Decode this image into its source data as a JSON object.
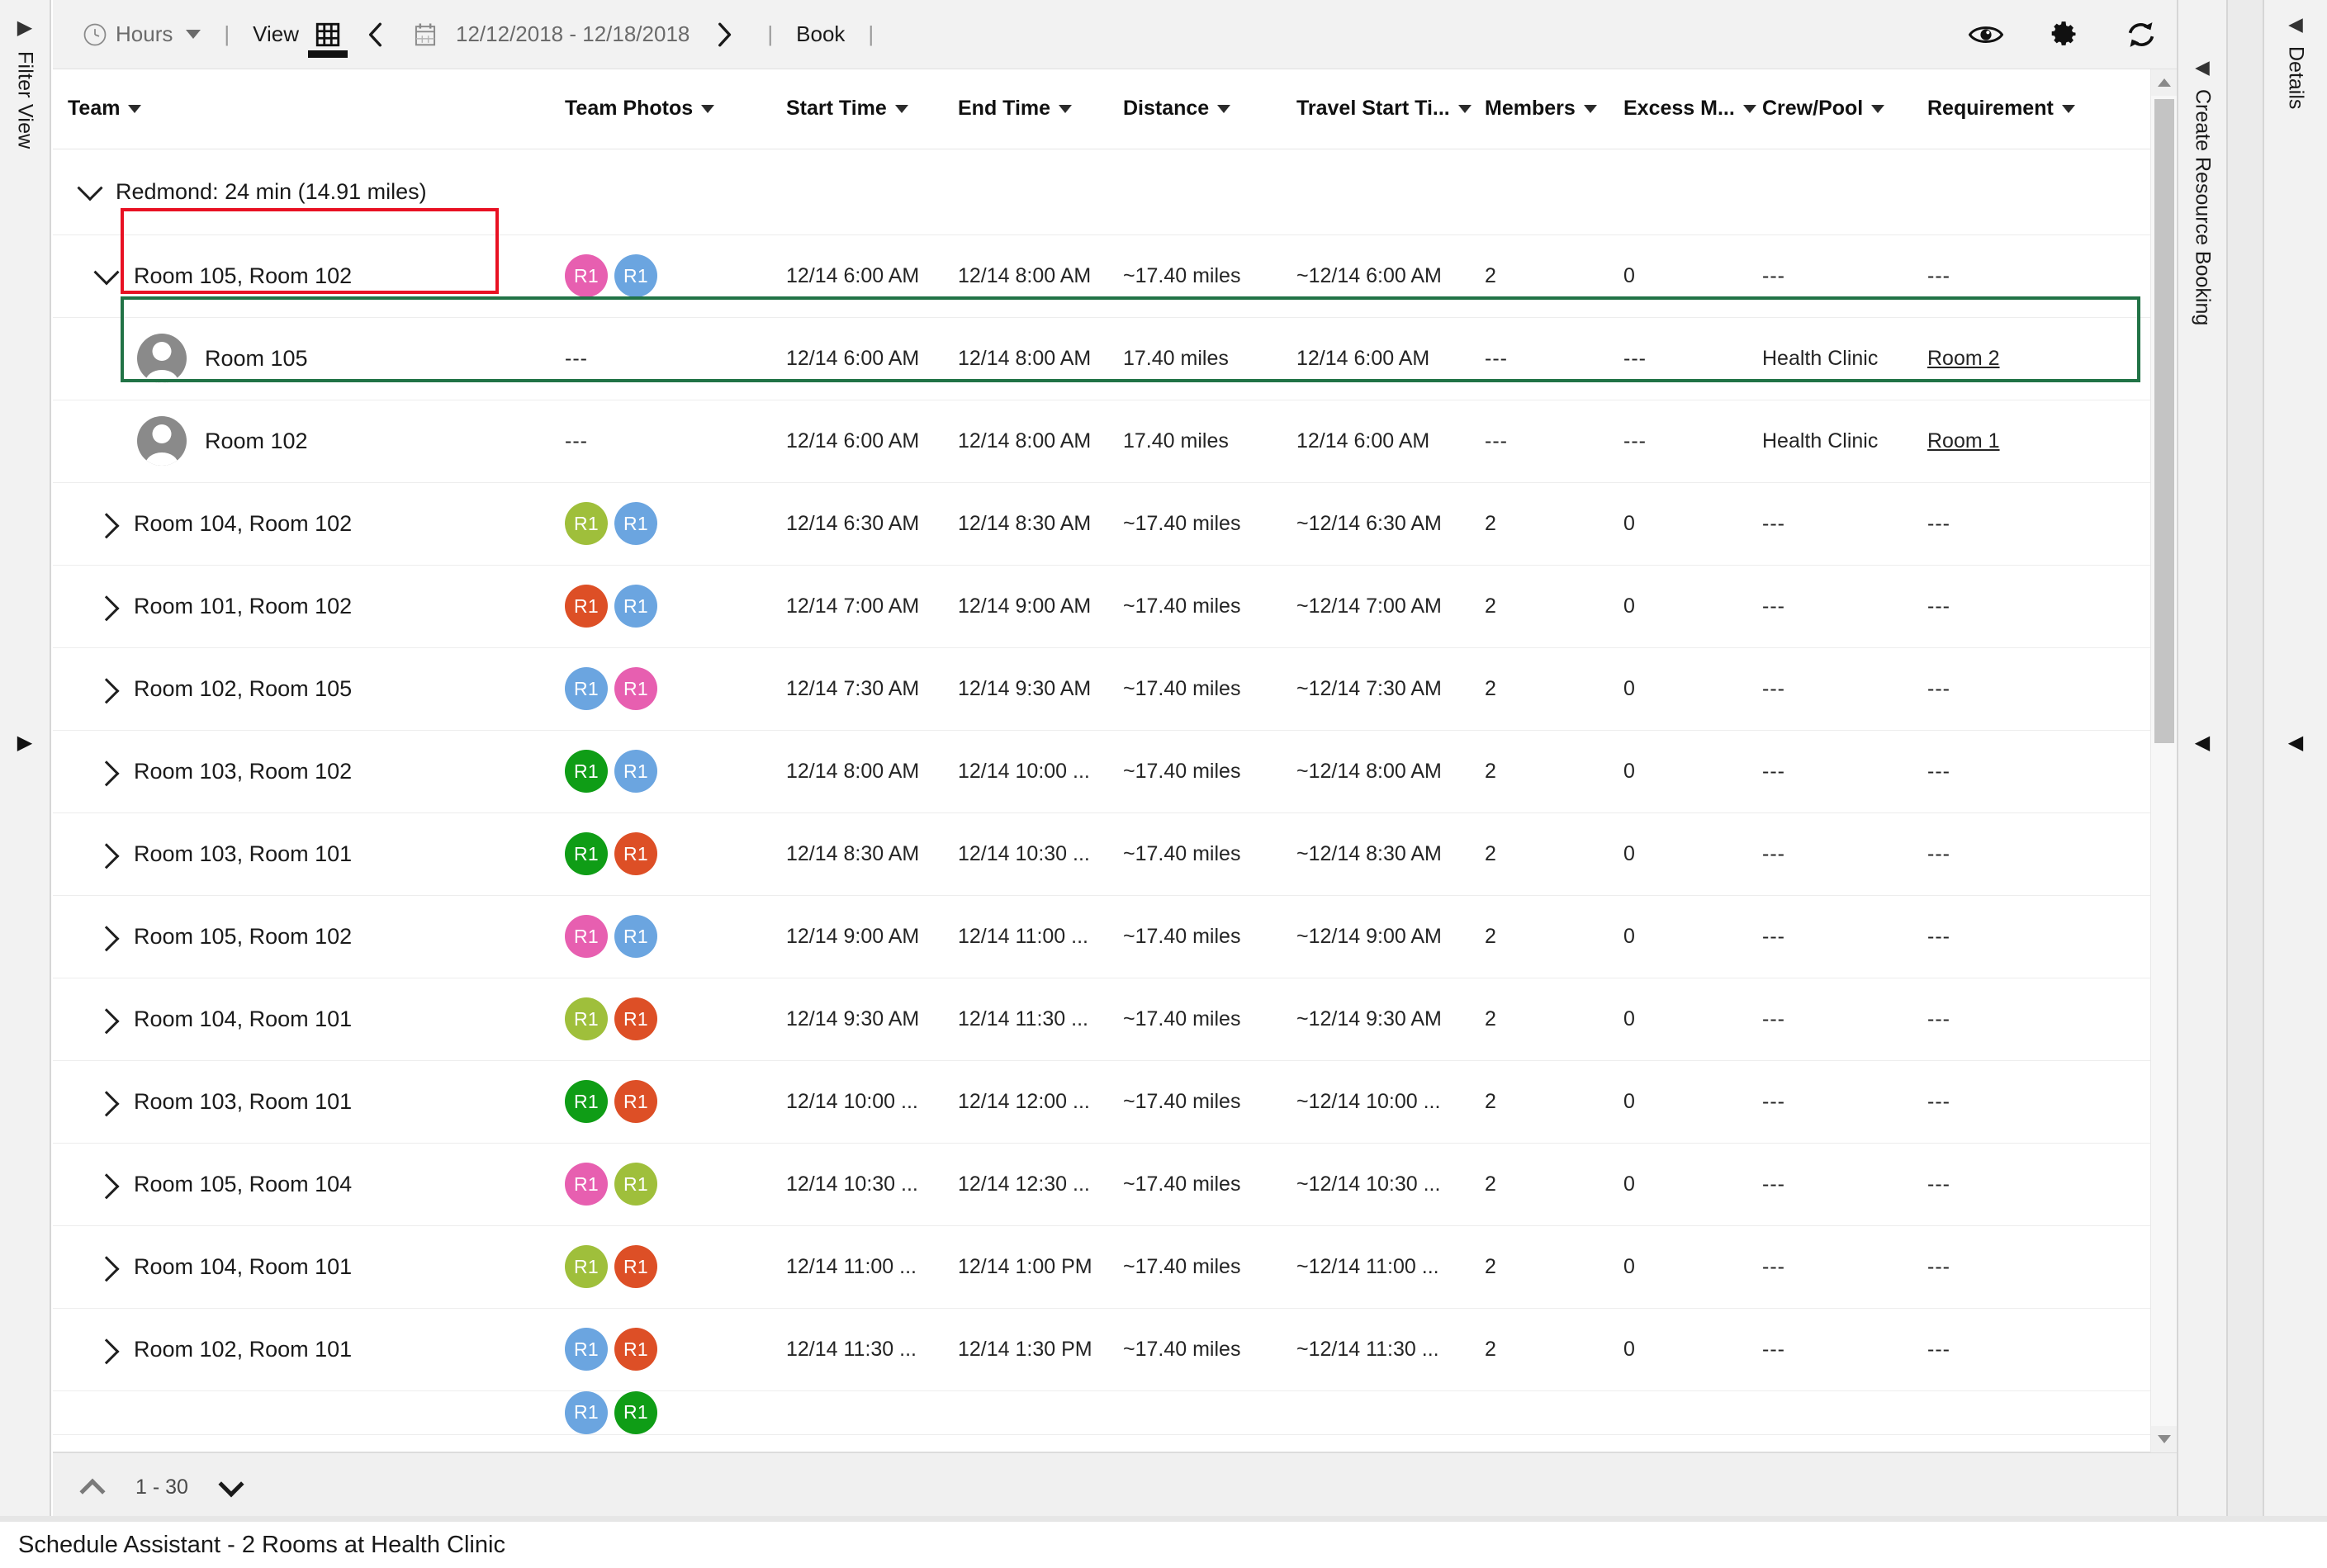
{
  "toolbar": {
    "hours_label": "Hours",
    "view_label": "View",
    "date_range": "12/12/2018 - 12/18/2018",
    "book_label": "Book",
    "separator": "|",
    "icons": {
      "clock": "clock-icon",
      "dropdown": "chevron-down-icon",
      "grid_view": "grid-view-icon",
      "prev": "chevron-left-icon",
      "calendar": "calendar-icon",
      "next": "chevron-right-icon",
      "eye": "eye-icon",
      "settings": "gear-icon",
      "refresh": "refresh-icon"
    }
  },
  "left_rail": {
    "label": "Filter View",
    "expand_arrow": "▶",
    "bottom_arrow": "▶"
  },
  "right_rails": [
    {
      "label": "Create Resource Booking",
      "arrow": "◀",
      "bottom_arrow": "◀"
    },
    {
      "label": "Details",
      "arrow": "◀",
      "bottom_arrow": "◀"
    }
  ],
  "columns": [
    {
      "key": "team",
      "label": "Team"
    },
    {
      "key": "photos",
      "label": "Team Photos"
    },
    {
      "key": "start",
      "label": "Start Time"
    },
    {
      "key": "end",
      "label": "End Time"
    },
    {
      "key": "distance",
      "label": "Distance"
    },
    {
      "key": "travel",
      "label": "Travel Start Ti..."
    },
    {
      "key": "members",
      "label": "Members"
    },
    {
      "key": "excess",
      "label": "Excess M..."
    },
    {
      "key": "crew",
      "label": "Crew/Pool"
    },
    {
      "key": "requirement",
      "label": "Requirement"
    }
  ],
  "group": {
    "label": "Redmond: 24 min (14.91 miles)",
    "expanded": true,
    "highlight_color": "#e81123"
  },
  "selection": {
    "outline_color": "#217346"
  },
  "avatar_colors": {
    "pink": "#e75fb0",
    "blue": "#6ba5e0",
    "olive": "#9fbf3b",
    "orange": "#dd4f26",
    "green": "#0f9d16"
  },
  "rows": [
    {
      "level": 1,
      "expanded": true,
      "name": "Room 105, Room 102",
      "avatars": [
        {
          "label": "R1",
          "color": "#e75fb0"
        },
        {
          "label": "R1",
          "color": "#6ba5e0"
        }
      ],
      "start": "12/14 6:00 AM",
      "end": "12/14 8:00 AM",
      "distance": "~17.40 miles",
      "travel": "~12/14 6:00 AM",
      "members": "2",
      "excess": "0",
      "crew": "---",
      "requirement": "---",
      "requirement_link": false
    },
    {
      "level": 2,
      "person": true,
      "name": "Room 105",
      "photos": "---",
      "start": "12/14 6:00 AM",
      "end": "12/14 8:00 AM",
      "distance": "17.40 miles",
      "travel": "12/14 6:00 AM",
      "members": "---",
      "excess": "---",
      "crew": "Health Clinic",
      "requirement": "Room 2",
      "requirement_link": true
    },
    {
      "level": 2,
      "person": true,
      "name": "Room 102",
      "photos": "---",
      "start": "12/14 6:00 AM",
      "end": "12/14 8:00 AM",
      "distance": "17.40 miles",
      "travel": "12/14 6:00 AM",
      "members": "---",
      "excess": "---",
      "crew": "Health Clinic",
      "requirement": "Room 1",
      "requirement_link": true
    },
    {
      "level": 1,
      "expanded": false,
      "name": "Room 104, Room 102",
      "avatars": [
        {
          "label": "R1",
          "color": "#9fbf3b"
        },
        {
          "label": "R1",
          "color": "#6ba5e0"
        }
      ],
      "start": "12/14 6:30 AM",
      "end": "12/14 8:30 AM",
      "distance": "~17.40 miles",
      "travel": "~12/14 6:30 AM",
      "members": "2",
      "excess": "0",
      "crew": "---",
      "requirement": "---",
      "requirement_link": false
    },
    {
      "level": 1,
      "expanded": false,
      "name": "Room 101, Room 102",
      "avatars": [
        {
          "label": "R1",
          "color": "#dd4f26"
        },
        {
          "label": "R1",
          "color": "#6ba5e0"
        }
      ],
      "start": "12/14 7:00 AM",
      "end": "12/14 9:00 AM",
      "distance": "~17.40 miles",
      "travel": "~12/14 7:00 AM",
      "members": "2",
      "excess": "0",
      "crew": "---",
      "requirement": "---",
      "requirement_link": false
    },
    {
      "level": 1,
      "expanded": false,
      "name": "Room 102, Room 105",
      "avatars": [
        {
          "label": "R1",
          "color": "#6ba5e0"
        },
        {
          "label": "R1",
          "color": "#e75fb0"
        }
      ],
      "start": "12/14 7:30 AM",
      "end": "12/14 9:30 AM",
      "distance": "~17.40 miles",
      "travel": "~12/14 7:30 AM",
      "members": "2",
      "excess": "0",
      "crew": "---",
      "requirement": "---",
      "requirement_link": false
    },
    {
      "level": 1,
      "expanded": false,
      "name": "Room 103, Room 102",
      "avatars": [
        {
          "label": "R1",
          "color": "#0f9d16"
        },
        {
          "label": "R1",
          "color": "#6ba5e0"
        }
      ],
      "start": "12/14 8:00 AM",
      "end": "12/14 10:00 ...",
      "distance": "~17.40 miles",
      "travel": "~12/14 8:00 AM",
      "members": "2",
      "excess": "0",
      "crew": "---",
      "requirement": "---",
      "requirement_link": false
    },
    {
      "level": 1,
      "expanded": false,
      "name": "Room 103, Room 101",
      "avatars": [
        {
          "label": "R1",
          "color": "#0f9d16"
        },
        {
          "label": "R1",
          "color": "#dd4f26"
        }
      ],
      "start": "12/14 8:30 AM",
      "end": "12/14 10:30 ...",
      "distance": "~17.40 miles",
      "travel": "~12/14 8:30 AM",
      "members": "2",
      "excess": "0",
      "crew": "---",
      "requirement": "---",
      "requirement_link": false
    },
    {
      "level": 1,
      "expanded": false,
      "name": "Room 105, Room 102",
      "avatars": [
        {
          "label": "R1",
          "color": "#e75fb0"
        },
        {
          "label": "R1",
          "color": "#6ba5e0"
        }
      ],
      "start": "12/14 9:00 AM",
      "end": "12/14 11:00 ...",
      "distance": "~17.40 miles",
      "travel": "~12/14 9:00 AM",
      "members": "2",
      "excess": "0",
      "crew": "---",
      "requirement": "---",
      "requirement_link": false
    },
    {
      "level": 1,
      "expanded": false,
      "name": "Room 104, Room 101",
      "avatars": [
        {
          "label": "R1",
          "color": "#9fbf3b"
        },
        {
          "label": "R1",
          "color": "#dd4f26"
        }
      ],
      "start": "12/14 9:30 AM",
      "end": "12/14 11:30 ...",
      "distance": "~17.40 miles",
      "travel": "~12/14 9:30 AM",
      "members": "2",
      "excess": "0",
      "crew": "---",
      "requirement": "---",
      "requirement_link": false
    },
    {
      "level": 1,
      "expanded": false,
      "name": "Room 103, Room 101",
      "avatars": [
        {
          "label": "R1",
          "color": "#0f9d16"
        },
        {
          "label": "R1",
          "color": "#dd4f26"
        }
      ],
      "start": "12/14 10:00 ...",
      "end": "12/14 12:00 ...",
      "distance": "~17.40 miles",
      "travel": "~12/14 10:00 ...",
      "members": "2",
      "excess": "0",
      "crew": "---",
      "requirement": "---",
      "requirement_link": false
    },
    {
      "level": 1,
      "expanded": false,
      "name": "Room 105, Room 104",
      "avatars": [
        {
          "label": "R1",
          "color": "#e75fb0"
        },
        {
          "label": "R1",
          "color": "#9fbf3b"
        }
      ],
      "start": "12/14 10:30 ...",
      "end": "12/14 12:30 ...",
      "distance": "~17.40 miles",
      "travel": "~12/14 10:30 ...",
      "members": "2",
      "excess": "0",
      "crew": "---",
      "requirement": "---",
      "requirement_link": false
    },
    {
      "level": 1,
      "expanded": false,
      "name": "Room 104, Room 101",
      "avatars": [
        {
          "label": "R1",
          "color": "#9fbf3b"
        },
        {
          "label": "R1",
          "color": "#dd4f26"
        }
      ],
      "start": "12/14 11:00 ...",
      "end": "12/14 1:00 PM",
      "distance": "~17.40 miles",
      "travel": "~12/14 11:00 ...",
      "members": "2",
      "excess": "0",
      "crew": "---",
      "requirement": "---",
      "requirement_link": false
    },
    {
      "level": 1,
      "expanded": false,
      "name": "Room 102, Room 101",
      "avatars": [
        {
          "label": "R1",
          "color": "#6ba5e0"
        },
        {
          "label": "R1",
          "color": "#dd4f26"
        }
      ],
      "start": "12/14 11:30 ...",
      "end": "12/14 1:30 PM",
      "distance": "~17.40 miles",
      "travel": "~12/14 11:30 ...",
      "members": "2",
      "excess": "0",
      "crew": "---",
      "requirement": "---",
      "requirement_link": false
    },
    {
      "level": 1,
      "expanded": false,
      "partial": true,
      "name": "",
      "avatars": [
        {
          "label": "R1",
          "color": "#6ba5e0"
        },
        {
          "label": "R1",
          "color": "#0f9d16"
        }
      ],
      "start": "",
      "end": "",
      "distance": "",
      "travel": "",
      "members": "",
      "excess": "",
      "crew": "",
      "requirement": "",
      "requirement_link": false
    }
  ],
  "pager": {
    "range": "1 - 30",
    "up_icon": "chevron-up-icon",
    "down_icon": "chevron-down-icon"
  },
  "status": {
    "text": "Schedule Assistant - 2 Rooms at Health Clinic"
  }
}
